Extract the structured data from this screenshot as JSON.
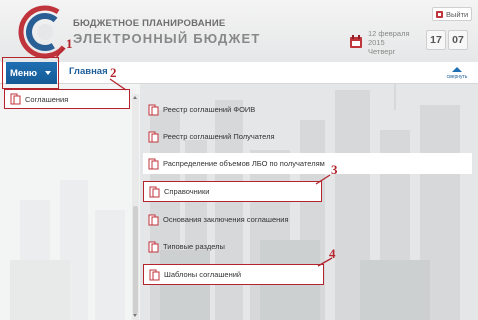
{
  "header": {
    "brand_top": "БЮДЖЕТНОЕ ПЛАНИРОВАНИЕ",
    "brand_main": "ЭЛЕКТРОННЫЙ БЮДЖЕТ",
    "exit_label": "Выйти",
    "date": {
      "day_month": "12 февраля",
      "year": "2015",
      "weekday": "Четверг"
    },
    "time": {
      "hours": "17",
      "minutes": "07"
    }
  },
  "navbar": {
    "menu_label": "Меню",
    "home_label": "Главная",
    "collapse_label": "свернуть"
  },
  "left_menu": {
    "items": [
      {
        "label": "Соглашения",
        "selected": true
      }
    ]
  },
  "submenu": {
    "items": [
      {
        "label": "Реестр соглашений ФОИВ"
      },
      {
        "label": "Реестр соглашений Получателя"
      },
      {
        "label": "Распределение объемов ЛБО по получателям"
      },
      {
        "label": "Справочники"
      },
      {
        "label": "Основания заключения соглашения"
      },
      {
        "label": "Типовые разделы"
      },
      {
        "label": "Шаблоны соглашений"
      }
    ]
  },
  "annotations": [
    "1",
    "2",
    "3",
    "4"
  ],
  "colors": {
    "accent_blue": "#1f6fb3",
    "link_blue": "#1f5f99",
    "annotation_red": "#b4242c",
    "logo_red": "#c0343c"
  }
}
